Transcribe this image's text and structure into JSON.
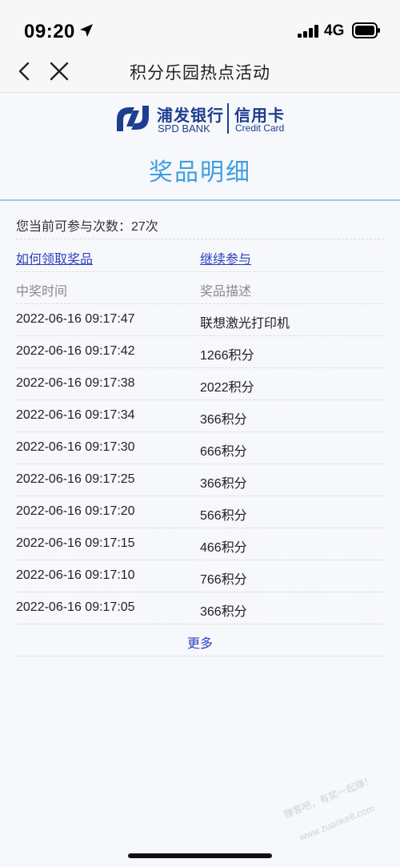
{
  "status_bar": {
    "time": "09:20",
    "network": "4G"
  },
  "nav": {
    "title": "积分乐园热点活动"
  },
  "brand": {
    "bank_cn": "浦发银行",
    "bank_en": "SPD BANK",
    "card_cn": "信用卡",
    "card_en": "Credit Card",
    "color": "#1d3d8f"
  },
  "page": {
    "title": "奖品明细",
    "title_color": "#3d9ee0",
    "chances_text": "您当前可参与次数：27次"
  },
  "links": {
    "how_to_claim": "如何领取奖品",
    "continue": "继续参与"
  },
  "table": {
    "headers": [
      "中奖时间",
      "奖品描述"
    ],
    "rows": [
      {
        "time": "2022-06-16 09:17:47",
        "prize": "联想激光打印机"
      },
      {
        "time": "2022-06-16 09:17:42",
        "prize": "1266积分"
      },
      {
        "time": "2022-06-16 09:17:38",
        "prize": "2022积分"
      },
      {
        "time": "2022-06-16 09:17:34",
        "prize": "366积分"
      },
      {
        "time": "2022-06-16 09:17:30",
        "prize": "666积分"
      },
      {
        "time": "2022-06-16 09:17:25",
        "prize": "366积分"
      },
      {
        "time": "2022-06-16 09:17:20",
        "prize": "566积分"
      },
      {
        "time": "2022-06-16 09:17:15",
        "prize": "466积分"
      },
      {
        "time": "2022-06-16 09:17:10",
        "prize": "766积分"
      },
      {
        "time": "2022-06-16 09:17:05",
        "prize": "366积分"
      }
    ],
    "more_label": "更多"
  },
  "watermark": {
    "text": "赚客吧，有奖一起赚！",
    "url": "www.zuanke8.com"
  },
  "icons": [
    "location-arrow-icon",
    "signal-icon",
    "battery-icon",
    "back-chevron-icon",
    "close-icon",
    "spd-logo-icon"
  ]
}
